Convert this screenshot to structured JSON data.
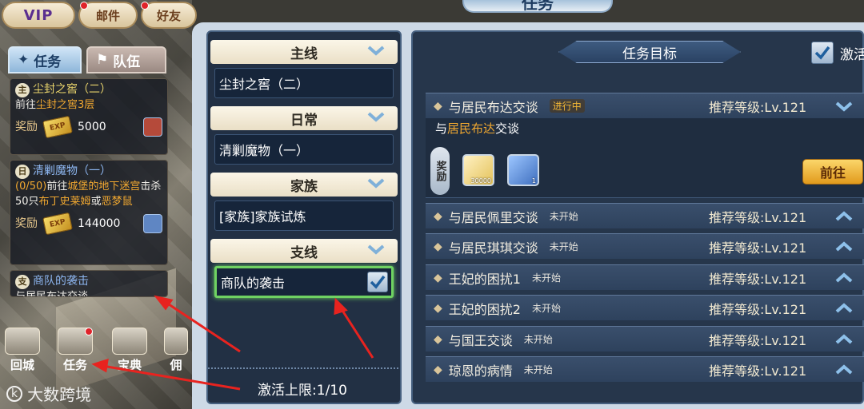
{
  "topbar": {
    "vip": "VIP",
    "mail": "邮件",
    "friends": "好友"
  },
  "side": {
    "tabs": [
      {
        "label": "任务"
      },
      {
        "label": "队伍"
      }
    ],
    "quests": [
      {
        "tag": "主",
        "title": "尘封之窖（二）",
        "desc_prefix": "前往",
        "desc_hl": "尘封之窖3层",
        "reward_label": "奖励",
        "reward_value": "5000"
      },
      {
        "tag": "日",
        "title": "清剿魔物（一）",
        "progress": "(0/50)",
        "desc_1": "前往",
        "desc_hl1": "城堡的地下迷宫",
        "desc_2": "击杀50只",
        "desc_hl2": "布丁史莱姆",
        "desc_3": "或",
        "desc_hl3": "恶梦鼠",
        "reward_label": "奖励",
        "reward_value": "144000"
      },
      {
        "tag": "支",
        "title": "商队的袭击",
        "desc": "与居民布达交谈"
      }
    ],
    "exp_icon": "EXP",
    "nav": [
      {
        "label": "回城"
      },
      {
        "label": "任务"
      },
      {
        "label": "宝典"
      },
      {
        "label": "佣"
      }
    ],
    "watermark_logo": "k",
    "watermark": "大数跨境"
  },
  "panel": {
    "header": "任务",
    "categories": [
      {
        "label": "主线",
        "item": "尘封之窖（二）"
      },
      {
        "label": "日常",
        "item": "清剿魔物（一）"
      },
      {
        "label": "家族",
        "item": "[家族]家族试炼"
      },
      {
        "label": "支线",
        "item": "商队的袭击"
      }
    ],
    "limit": "激活上限:1/10",
    "target_title": "任务目标",
    "activate_label": "激活",
    "expanded": {
      "title": "与居民布达交谈",
      "status": "进行中",
      "level": "推荐等级:Lv.121",
      "desc_prefix": "与",
      "desc_hl": "居民布达",
      "desc_suffix": "交谈",
      "reward_label": "奖励",
      "item1_qty": "30000",
      "item2_qty": "1",
      "go_label": "前往"
    },
    "rows": [
      {
        "title": "与居民佩里交谈",
        "status": "未开始",
        "level": "推荐等级:Lv.121"
      },
      {
        "title": "与居民琪琪交谈",
        "status": "未开始",
        "level": "推荐等级:Lv.121"
      },
      {
        "title": "王妃的困扰1",
        "status": "未开始",
        "level": "推荐等级:Lv.121"
      },
      {
        "title": "王妃的困扰2",
        "status": "未开始",
        "level": "推荐等级:Lv.121"
      },
      {
        "title": "与国王交谈",
        "status": "未开始",
        "level": "推荐等级:Lv.121"
      },
      {
        "title": "琼恩的病情",
        "status": "未开始",
        "level": "推荐等级:Lv.121"
      }
    ]
  },
  "colors": {
    "accent_gold": "#f1a830",
    "select_green": "#6fd262",
    "panel_dark": "#26364b"
  }
}
